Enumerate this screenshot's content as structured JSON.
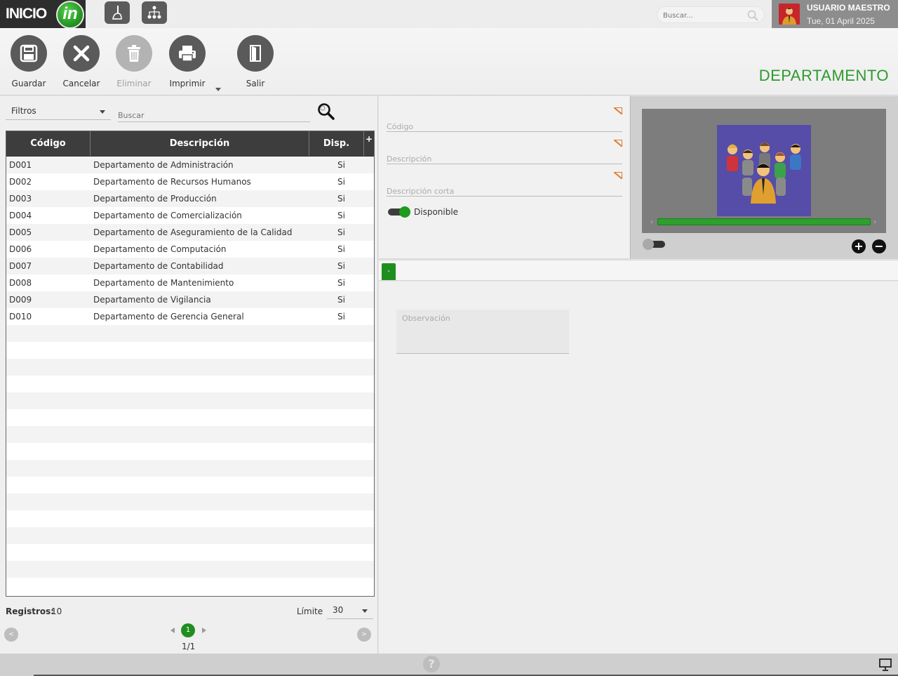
{
  "header": {
    "logo_text": "INICIO",
    "logo_badge": "in",
    "search_placeholder": "Buscar...",
    "user_name": "USUARIO MAESTRO",
    "user_date": "Tue, 01 April 2025"
  },
  "toolbar": {
    "guardar": "Guardar",
    "cancelar": "Cancelar",
    "eliminar": "Eliminar",
    "imprimir": "Imprimir",
    "salir": "Salir",
    "title": "DEPARTAMENTO"
  },
  "left": {
    "filter_label": "Filtros",
    "search_placeholder": "Buscar",
    "columns": {
      "codigo": "Código",
      "descripcion": "Descripción",
      "disp": "Disp.",
      "add": "+"
    },
    "rows": [
      {
        "codigo": "D001",
        "descripcion": "Departamento de Administración",
        "disp": "Si"
      },
      {
        "codigo": "D002",
        "descripcion": "Departamento de Recursos Humanos",
        "disp": "Si"
      },
      {
        "codigo": "D003",
        "descripcion": "Departamento de Producción",
        "disp": "Si"
      },
      {
        "codigo": "D004",
        "descripcion": "Departamento de Comercialización",
        "disp": "Si"
      },
      {
        "codigo": "D005",
        "descripcion": "Departamento de Aseguramiento de la Calidad",
        "disp": "Si"
      },
      {
        "codigo": "D006",
        "descripcion": "Departamento de Computación",
        "disp": "Si"
      },
      {
        "codigo": "D007",
        "descripcion": "Departamento de Contabilidad",
        "disp": "Si"
      },
      {
        "codigo": "D008",
        "descripcion": "Departamento de Mantenimiento",
        "disp": "Si"
      },
      {
        "codigo": "D009",
        "descripcion": "Departamento de Vigilancia",
        "disp": "Si"
      },
      {
        "codigo": "D010",
        "descripcion": "Departamento de Gerencia General",
        "disp": "Si"
      }
    ],
    "registros_label": "Registros:",
    "registros_value": "10",
    "limite_label": "Límite",
    "limite_value": "30",
    "current_page": "1",
    "page_count": "1/1",
    "scroll_left": "<",
    "scroll_right": ">"
  },
  "form": {
    "codigo_placeholder": "Código",
    "descripcion_placeholder": "Descripción",
    "descripcion_corta_placeholder": "Descripción corta",
    "disponible_label": "Disponible",
    "disponible_on": true
  },
  "image_panel": {
    "slider_left": "‹",
    "slider_right": "›",
    "zoom_in": "+",
    "zoom_out": "−"
  },
  "tabs": {
    "active_tab": "-"
  },
  "detail": {
    "observacion_placeholder": "Observación"
  },
  "footer": {
    "help": "?"
  },
  "colors": {
    "accent_green": "#1e8f1e",
    "title_green": "#2e9a2e",
    "header_dark": "#3d3d3d",
    "flag_orange": "#e07b2e"
  }
}
